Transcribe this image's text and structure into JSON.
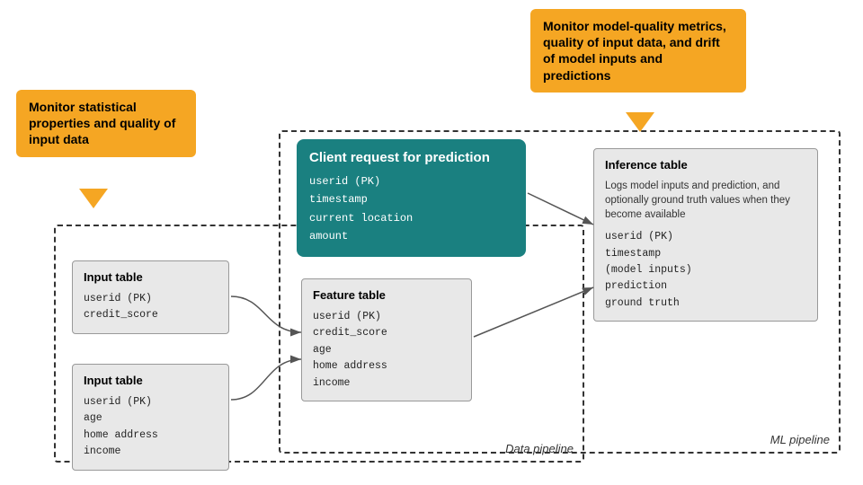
{
  "callouts": {
    "left": {
      "text": "Monitor statistical properties and quality of input data"
    },
    "right": {
      "text": "Monitor model-quality metrics, quality of input data, and drift of model inputs and predictions"
    }
  },
  "labels": {
    "ml_pipeline": "ML pipeline",
    "data_pipeline": "Data pipeline"
  },
  "client_request": {
    "title": "Client request for prediction",
    "fields": [
      "userid (PK)",
      "timestamp",
      "current location",
      "amount"
    ]
  },
  "input_table_1": {
    "title": "Input table",
    "fields": [
      "userid (PK)",
      "credit_score"
    ]
  },
  "input_table_2": {
    "title": "Input table",
    "fields": [
      "userid (PK)",
      "age",
      "home address",
      "income"
    ]
  },
  "feature_table": {
    "title": "Feature table",
    "fields": [
      "userid (PK)",
      "credit_score",
      "age",
      "home address",
      "income"
    ]
  },
  "inference_table": {
    "title": "Inference table",
    "description": "Logs model inputs and prediction, and optionally ground truth values when they become available",
    "fields": [
      "userid (PK)",
      "timestamp",
      "(model inputs)",
      "prediction",
      "ground truth"
    ]
  }
}
